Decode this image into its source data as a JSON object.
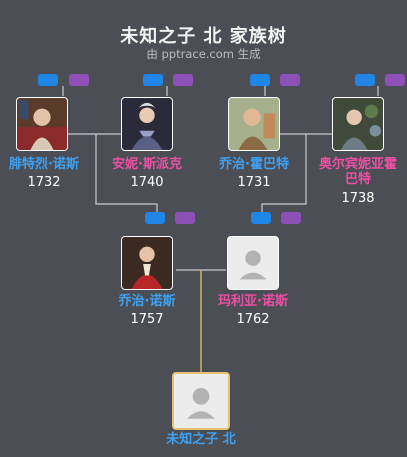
{
  "header": {
    "title": "未知之子 北 家族树",
    "subtitle": "由 pptrace.com 生成"
  },
  "people": {
    "gm_father": {
      "name": "腓特烈·诺斯",
      "year": "1732"
    },
    "gm_mother": {
      "name": "安妮·斯派克",
      "year": "1740"
    },
    "gf_father": {
      "name": "乔治·霍巴特",
      "year": "1731"
    },
    "gf_mother": {
      "name": "奥尔宾妮亚霍巴特",
      "year": "1738"
    },
    "father": {
      "name": "乔治·诺斯",
      "year": "1757"
    },
    "mother": {
      "name": "玛利亚·诺斯",
      "year": "1762"
    },
    "child": {
      "name": "未知之子 北"
    }
  },
  "colors": {
    "background": "#4b4f55",
    "male_name": "#3fa0f2",
    "female_name": "#ec4fa3",
    "root_border": "#e6c170",
    "connector": "#c9cbce",
    "root_connector": "#e2b95a"
  },
  "icons": {
    "placeholder": "person-silhouette-icon",
    "badge_blue": "blue-tag-icon",
    "badge_purple": "purple-tag-icon"
  }
}
